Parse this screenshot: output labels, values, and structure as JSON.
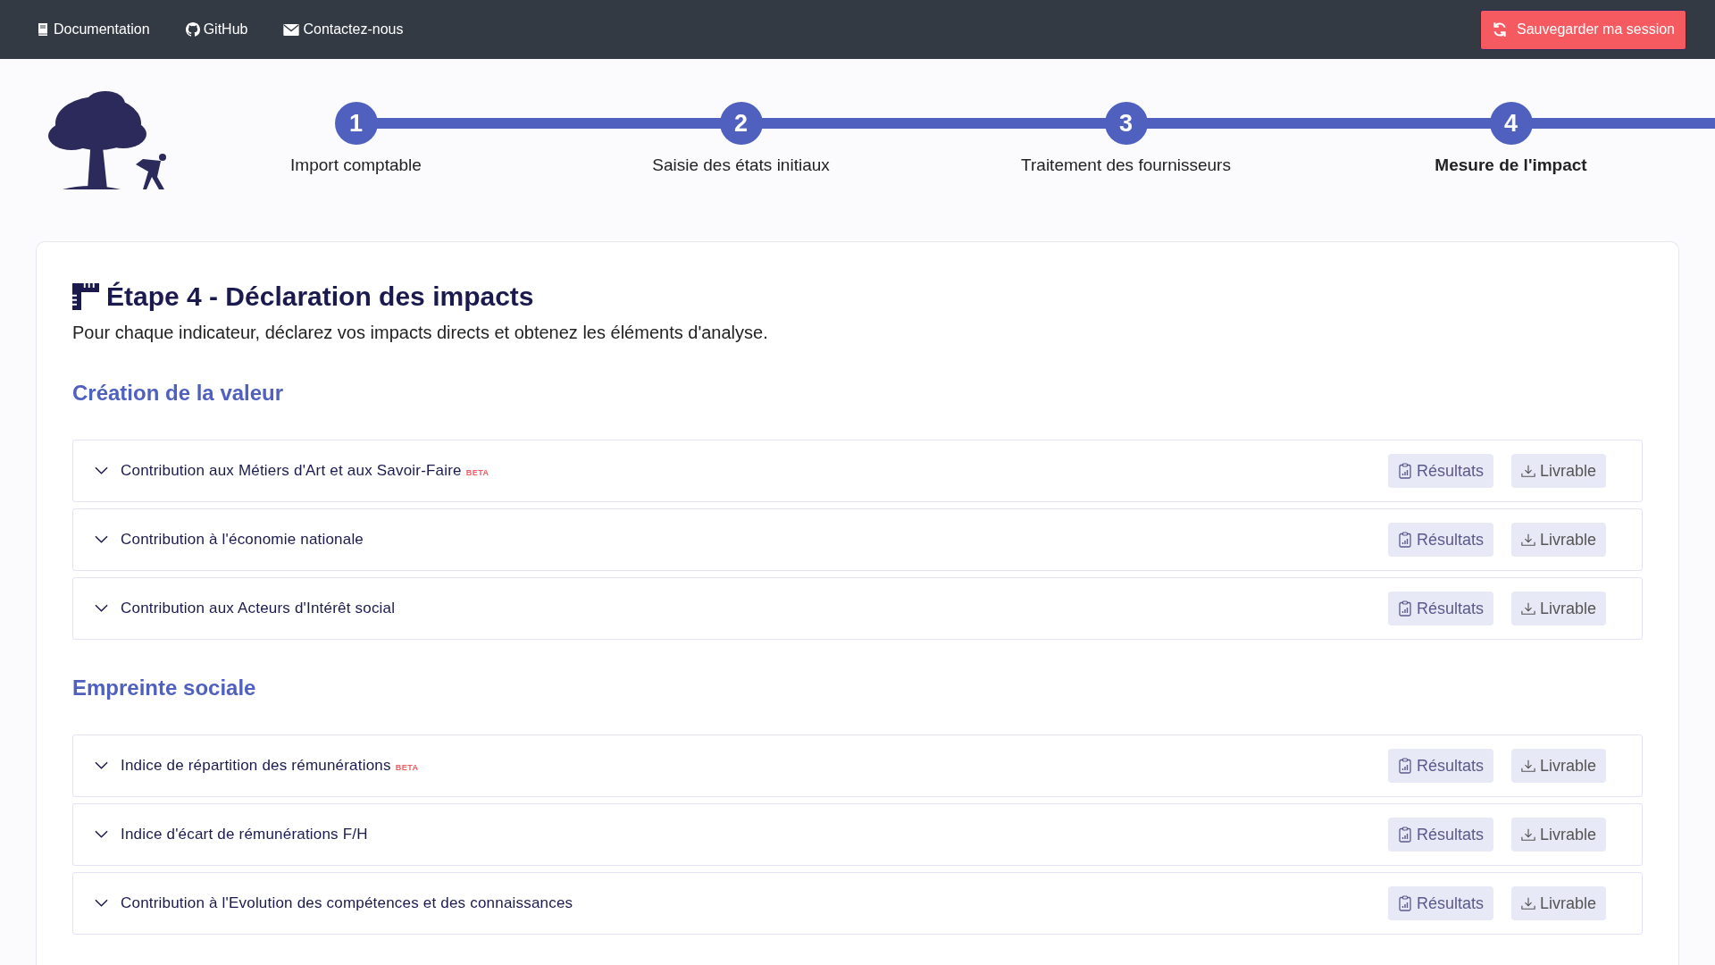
{
  "top_bar": {
    "links": [
      {
        "label": "Documentation",
        "kind": "book"
      },
      {
        "label": "GitHub",
        "kind": "github"
      },
      {
        "label": "Contactez-nous",
        "kind": "mail"
      }
    ],
    "save_button": "Sauvegarder ma session"
  },
  "stepper": [
    {
      "number": "1",
      "label": "Import comptable",
      "selected": false
    },
    {
      "number": "2",
      "label": "Saisie des états initiaux",
      "selected": false
    },
    {
      "number": "3",
      "label": "Traitement des fournisseurs",
      "selected": false
    },
    {
      "number": "4",
      "label": "Mesure de l'impact",
      "selected": true
    }
  ],
  "page": {
    "title": "Étape 4 - Déclaration des impacts",
    "subtitle": "Pour chaque indicateur, déclarez vos impacts directs et obtenez les éléments d'analyse."
  },
  "sections": [
    {
      "title": "Création de la valeur",
      "items": [
        {
          "label": "Contribution aux Métiers d'Art et aux Savoir-Faire",
          "badge": "BETA",
          "results": "Résultats",
          "deliverable": "Livrable",
          "expanded": false
        },
        {
          "label": "Contribution à l'économie nationale",
          "results": "Résultats",
          "deliverable": "Livrable",
          "expanded": false
        },
        {
          "label": "Contribution aux Acteurs d'Intérêt social",
          "results": "Résultats",
          "deliverable": "Livrable",
          "expanded": false
        }
      ]
    },
    {
      "title": "Empreinte sociale",
      "items": [
        {
          "label": "Indice de répartition des rémunérations",
          "badge": "BETA",
          "results": "Résultats",
          "deliverable": "Livrable",
          "expanded": false
        },
        {
          "label": "Indice d'écart de rémunérations F/H",
          "results": "Résultats",
          "deliverable": "Livrable",
          "expanded": false
        },
        {
          "label": "Contribution à l'Evolution des compétences et des connaissances",
          "results": "Résultats",
          "deliverable": "Livrable",
          "expanded": false
        }
      ]
    }
  ]
}
